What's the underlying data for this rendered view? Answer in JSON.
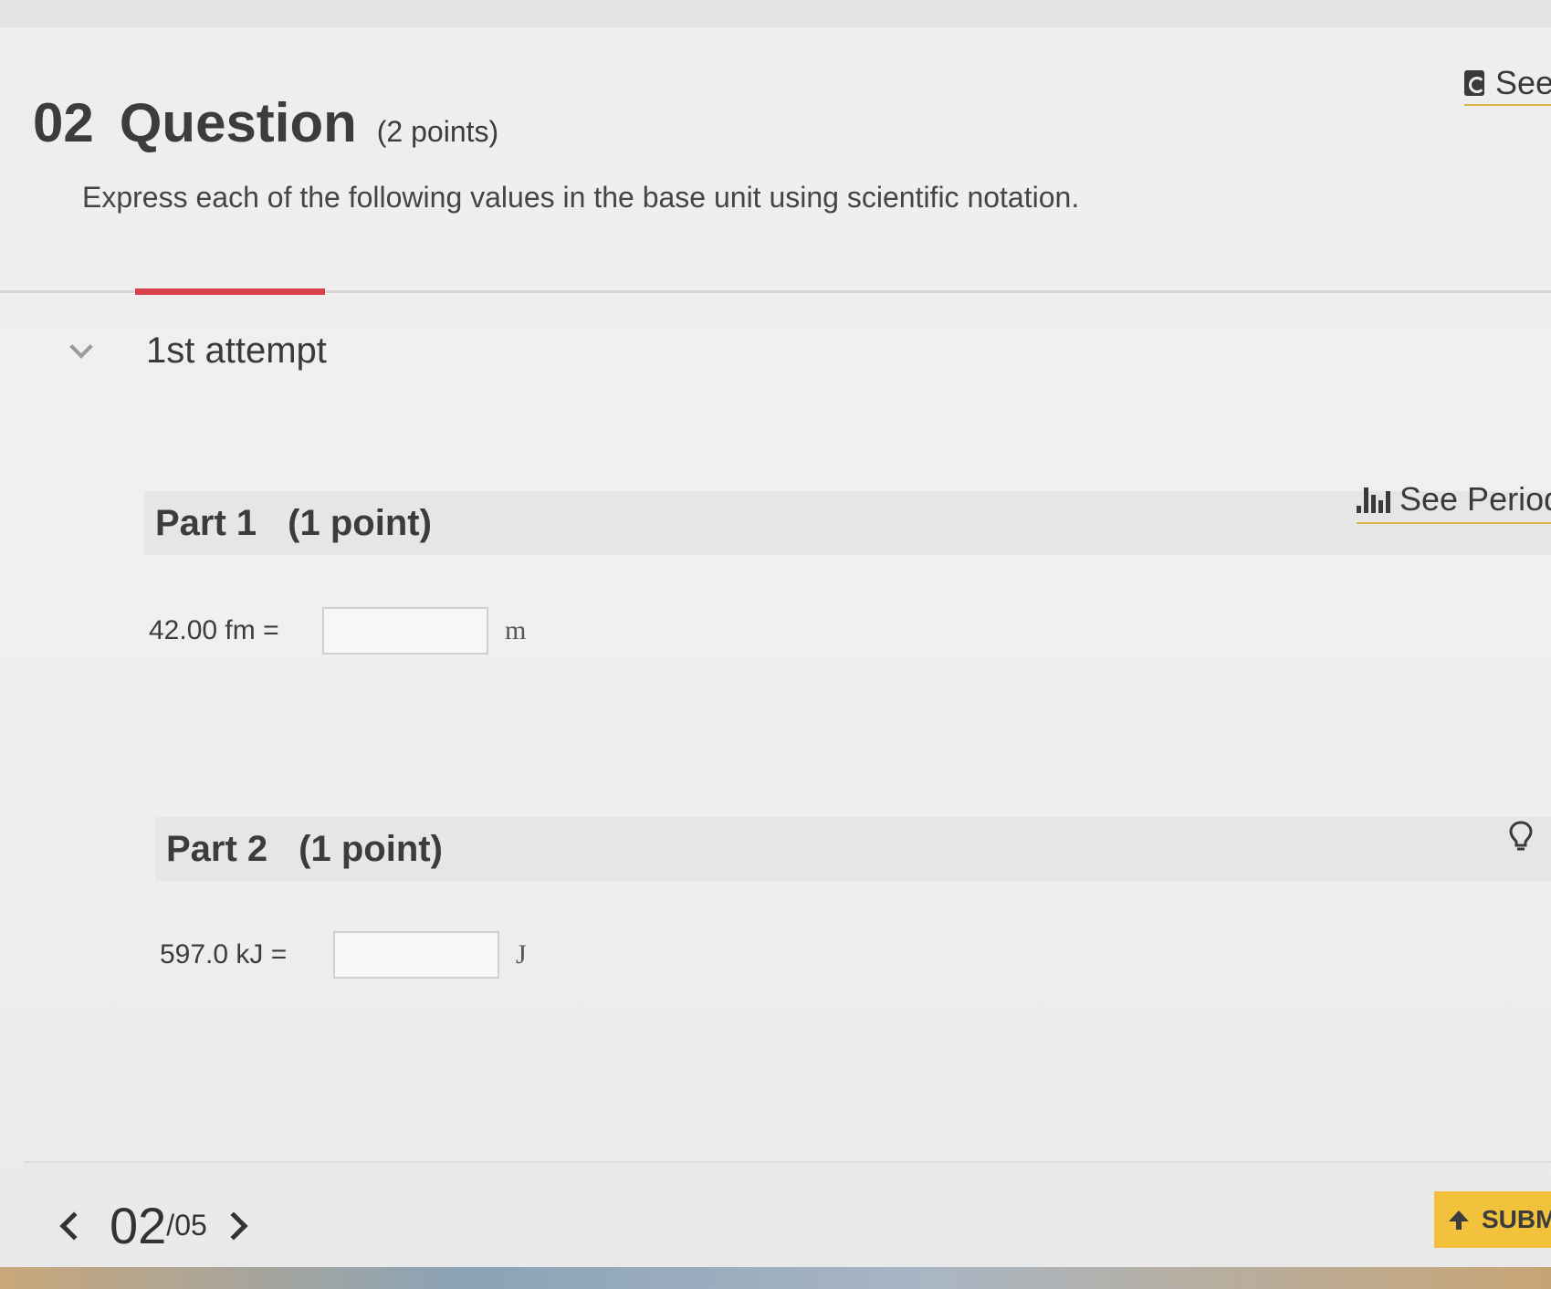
{
  "question": {
    "number": "02",
    "word": "Question",
    "points": "(2 points)",
    "instructions": "Express each of the following values in the base unit using scientific notation."
  },
  "header_links": {
    "ebook_label": "See"
  },
  "attempt": {
    "label": "1st attempt"
  },
  "parts": [
    {
      "title": "Part 1",
      "points": "(1 point)",
      "expression": "42.00 fm =",
      "answer_value": "",
      "unit": "m",
      "side_link": "See Periodi"
    },
    {
      "title": "Part 2",
      "points": "(1 point)",
      "expression": "597.0 kJ =",
      "answer_value": "",
      "unit": "J"
    }
  ],
  "pager": {
    "current": "02",
    "total": "/05"
  },
  "submit": {
    "label": "SUBM"
  },
  "colors": {
    "accent_red": "#d9424a",
    "submit_yellow": "#f2c23c",
    "link_underline": "#d9b24a"
  }
}
